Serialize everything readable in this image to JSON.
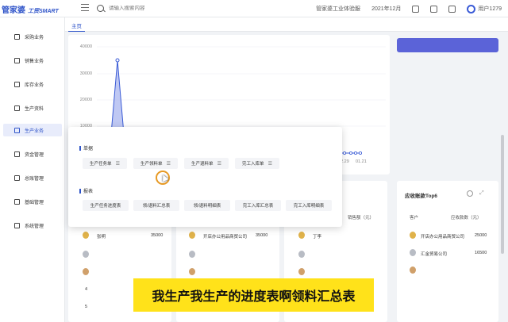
{
  "header": {
    "logo_text": "管家婆",
    "logo_sub": "工贸SMART",
    "search_placeholder": "请输入搜索内容",
    "company": "管家婆工业体验服",
    "period": "2021年12月",
    "user": "用户1279"
  },
  "sidebar": {
    "items": [
      {
        "label": "采购业务"
      },
      {
        "label": "销售业务"
      },
      {
        "label": "库存业务"
      },
      {
        "label": "生产资料"
      },
      {
        "label": "生产业务"
      },
      {
        "label": "资金管理"
      },
      {
        "label": "总账管理"
      },
      {
        "label": "基础管理"
      },
      {
        "label": "系统管理"
      }
    ],
    "active_index": 4
  },
  "tabs": [
    {
      "label": "主页"
    }
  ],
  "chart": {
    "y_ticks": [
      "40000",
      "30000",
      "20000",
      "10000"
    ],
    "x_ticks": [
      "12.29",
      "01.21"
    ]
  },
  "popup": {
    "section1_title": "单据",
    "docs": [
      {
        "label": "生产任务单"
      },
      {
        "label": "生产领料单"
      },
      {
        "label": "生产退料单"
      },
      {
        "label": "完工入库单"
      }
    ],
    "section2_title": "报表",
    "reports": [
      {
        "label": "生产任务进度表"
      },
      {
        "label": "领/退料汇总表"
      },
      {
        "label": "领/退料明细表"
      },
      {
        "label": "完工入库汇总表"
      },
      {
        "label": "完工入库明细表"
      }
    ]
  },
  "rank_cards": {
    "card1": {
      "rows": [
        {
          "name": "张明",
          "value": "35000"
        }
      ]
    },
    "card2": {
      "rows": [
        {
          "name": "开店办公用品商贸公司",
          "value": "35000"
        }
      ]
    },
    "card3": {
      "header_value": "销售额（元）",
      "rows": [
        {
          "name": "丁李"
        }
      ]
    },
    "card4": {
      "title": "应收账款Top6",
      "col_customer": "客户",
      "col_amount": "应收款数（元）",
      "rows": [
        {
          "name": "开店办公用品商贸公司",
          "value": "25000"
        },
        {
          "name": "汇金贸易公司",
          "value": "16500"
        }
      ]
    },
    "row_numbers": [
      "4",
      "5"
    ]
  },
  "caption": "我生产我生产的进度表啊领料汇总表"
}
